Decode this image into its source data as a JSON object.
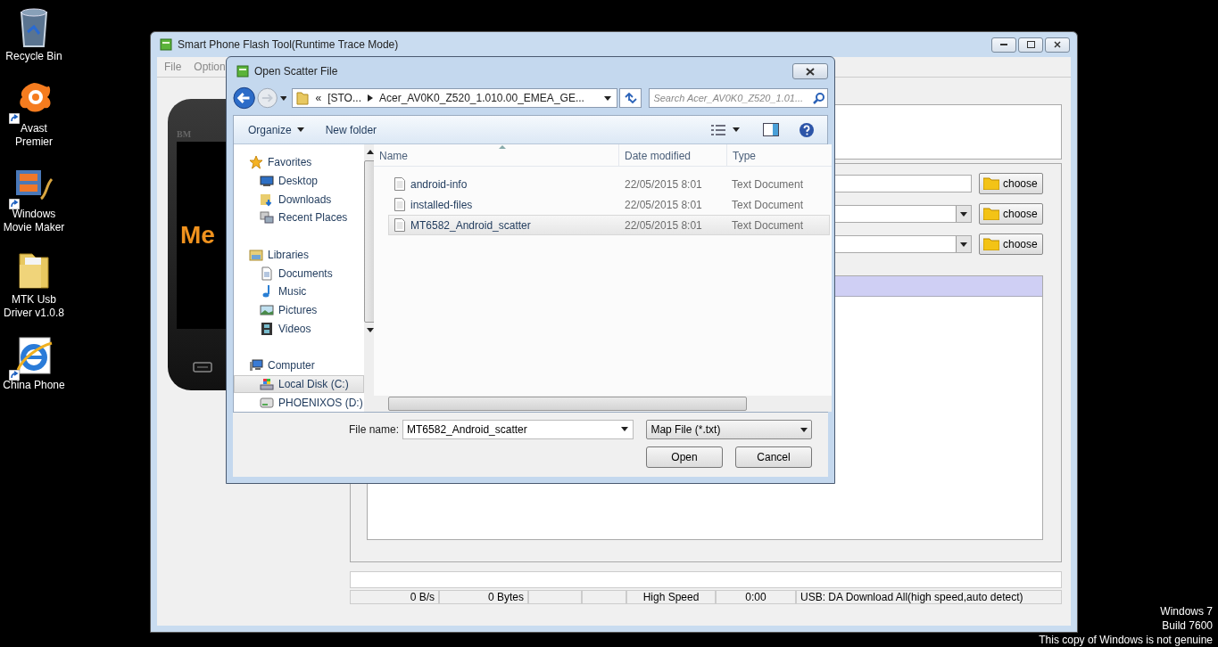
{
  "desktop": {
    "icons": [
      {
        "kind": "recycle",
        "label": "Recycle Bin",
        "shortcut": false
      },
      {
        "kind": "avast",
        "label": "Avast Premier",
        "shortcut": true
      },
      {
        "kind": "movie",
        "label": "Windows Movie Maker",
        "shortcut": true
      },
      {
        "kind": "folder",
        "label": "MTK Usb Driver v1.0.8",
        "shortcut": false
      },
      {
        "kind": "ie",
        "label": "China Phone",
        "shortcut": true
      }
    ],
    "watermark_lines": [
      "Windows 7",
      "Build 7600",
      "This copy of Windows is not genuine"
    ]
  },
  "main_window": {
    "title": "Smart Phone Flash Tool(Runtime Trace Mode)",
    "menu": [
      "File",
      "Option"
    ],
    "phone": {
      "brand": "BM",
      "screen_text": "Me"
    },
    "choose_rows": [
      {
        "kind": "field",
        "button": "choose"
      },
      {
        "kind": "dropdown",
        "button": "choose"
      },
      {
        "kind": "dropdown",
        "button": "choose"
      }
    ],
    "progress": {
      "level": 0
    },
    "status_bar": {
      "speed": "0 B/s",
      "bytes": "0 Bytes",
      "mode": "High Speed",
      "time": "0:00",
      "connection": "USB: DA Download All(high speed,auto detect)"
    }
  },
  "dialog": {
    "title": "Open Scatter File",
    "address": {
      "overflow": "«",
      "crumbs": [
        "[STO...",
        "Acer_AV0K0_Z520_1.010.00_EMEA_GE..."
      ]
    },
    "search": {
      "placeholder": "Search Acer_AV0K0_Z520_1.01..."
    },
    "toolbar": {
      "organize": "Organize",
      "new_folder": "New folder"
    },
    "nav": [
      {
        "kind": "star",
        "label": "Favorites",
        "selected": false,
        "children": [
          {
            "kind": "desktop",
            "label": "Desktop",
            "selected": false
          },
          {
            "kind": "downloads",
            "label": "Downloads",
            "selected": false
          },
          {
            "kind": "recent",
            "label": "Recent Places",
            "selected": false
          }
        ]
      },
      {
        "kind": "libraries",
        "label": "Libraries",
        "selected": false,
        "children": [
          {
            "kind": "document",
            "label": "Documents",
            "selected": false
          },
          {
            "kind": "music",
            "label": "Music",
            "selected": false
          },
          {
            "kind": "pictures",
            "label": "Pictures",
            "selected": false
          },
          {
            "kind": "videos",
            "label": "Videos",
            "selected": false
          }
        ]
      },
      {
        "kind": "computer",
        "label": "Computer",
        "selected": false,
        "children": [
          {
            "kind": "disk",
            "label": "Local Disk (C:)",
            "selected": true
          },
          {
            "kind": "drive",
            "label": "PHOENIXOS (D:)",
            "selected": false
          }
        ]
      }
    ],
    "columns": [
      "Name",
      "Date modified",
      "Type"
    ],
    "files": [
      {
        "name": "android-info",
        "date": "22/05/2015 8:01",
        "type": "Text Document",
        "selected": false
      },
      {
        "name": "installed-files",
        "date": "22/05/2015 8:01",
        "type": "Text Document",
        "selected": false
      },
      {
        "name": "MT6582_Android_scatter",
        "date": "22/05/2015 8:01",
        "type": "Text Document",
        "selected": true
      }
    ],
    "file_name": {
      "label": "File name:",
      "value": "MT6582_Android_scatter"
    },
    "filter": "Map File (*.txt)",
    "buttons": [
      "Open",
      "Cancel"
    ]
  }
}
